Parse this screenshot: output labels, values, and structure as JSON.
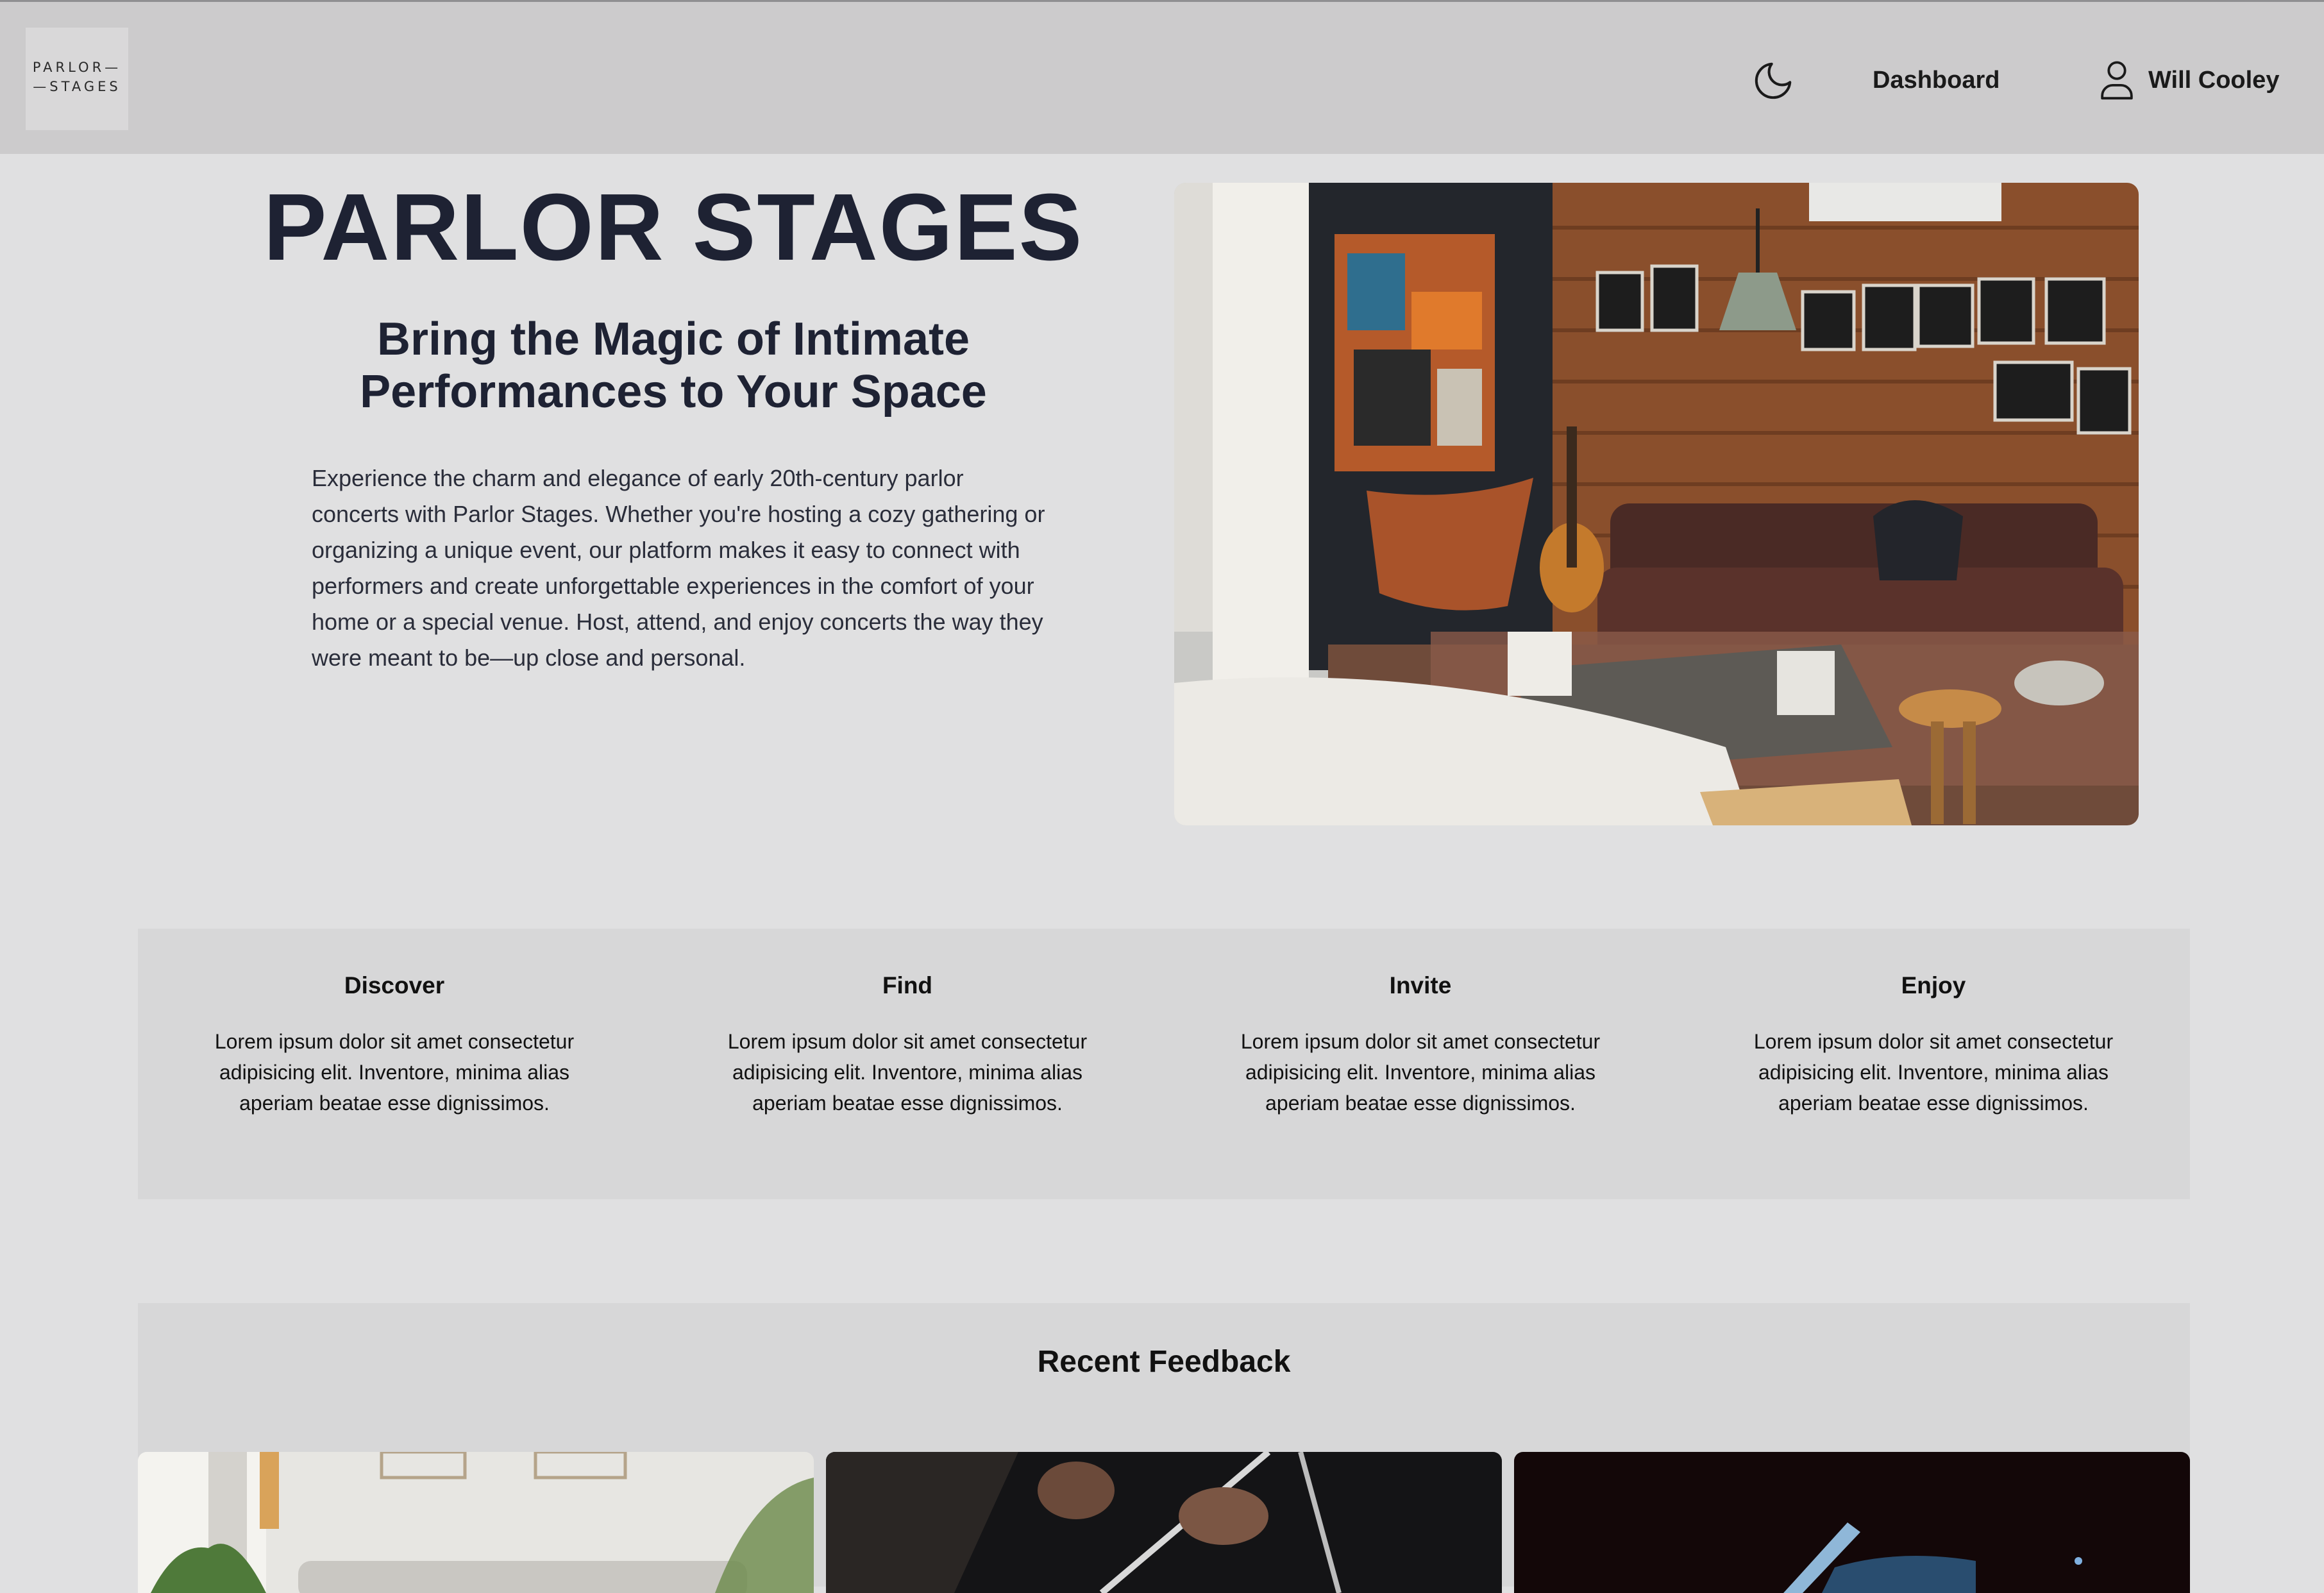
{
  "header": {
    "logo_line1": "PARLOR—",
    "logo_line2": "—STAGES",
    "theme_icon": "moon-icon",
    "nav_dashboard": "Dashboard",
    "user_icon": "user-icon",
    "user_name": "Will Cooley"
  },
  "hero": {
    "title": "PARLOR STAGES",
    "subtitle": "Bring the Magic of Intimate Performances to Your Space",
    "text": "Experience the charm and elegance of early 20th-century parlor concerts with Parlor Stages. Whether you're hosting a cozy gathering or organizing a unique event, our platform makes it easy to connect with performers and create unforgettable experiences in the comfort of your home or a special venue. Host, attend, and enjoy concerts the way they were meant to be—up close and personal."
  },
  "features": [
    {
      "title": "Discover",
      "text": "Lorem ipsum dolor sit amet consectetur adipisicing elit. Inventore, minima alias aperiam beatae esse dignissimos."
    },
    {
      "title": "Find",
      "text": "Lorem ipsum dolor sit amet consectetur adipisicing elit. Inventore, minima alias aperiam beatae esse dignissimos."
    },
    {
      "title": "Invite",
      "text": "Lorem ipsum dolor sit amet consectetur adipisicing elit. Inventore, minima alias aperiam beatae esse dignissimos."
    },
    {
      "title": "Enjoy",
      "text": "Lorem ipsum dolor sit amet consectetur adipisicing elit. Inventore, minima alias aperiam beatae esse dignissimos."
    }
  ],
  "feedback": {
    "title": "Recent Feedback"
  },
  "colors": {
    "header_bg": "#cccbcc",
    "page_bg": "#e0e0e1",
    "panel_bg": "#d7d7d8",
    "heading": "#1e2233"
  }
}
